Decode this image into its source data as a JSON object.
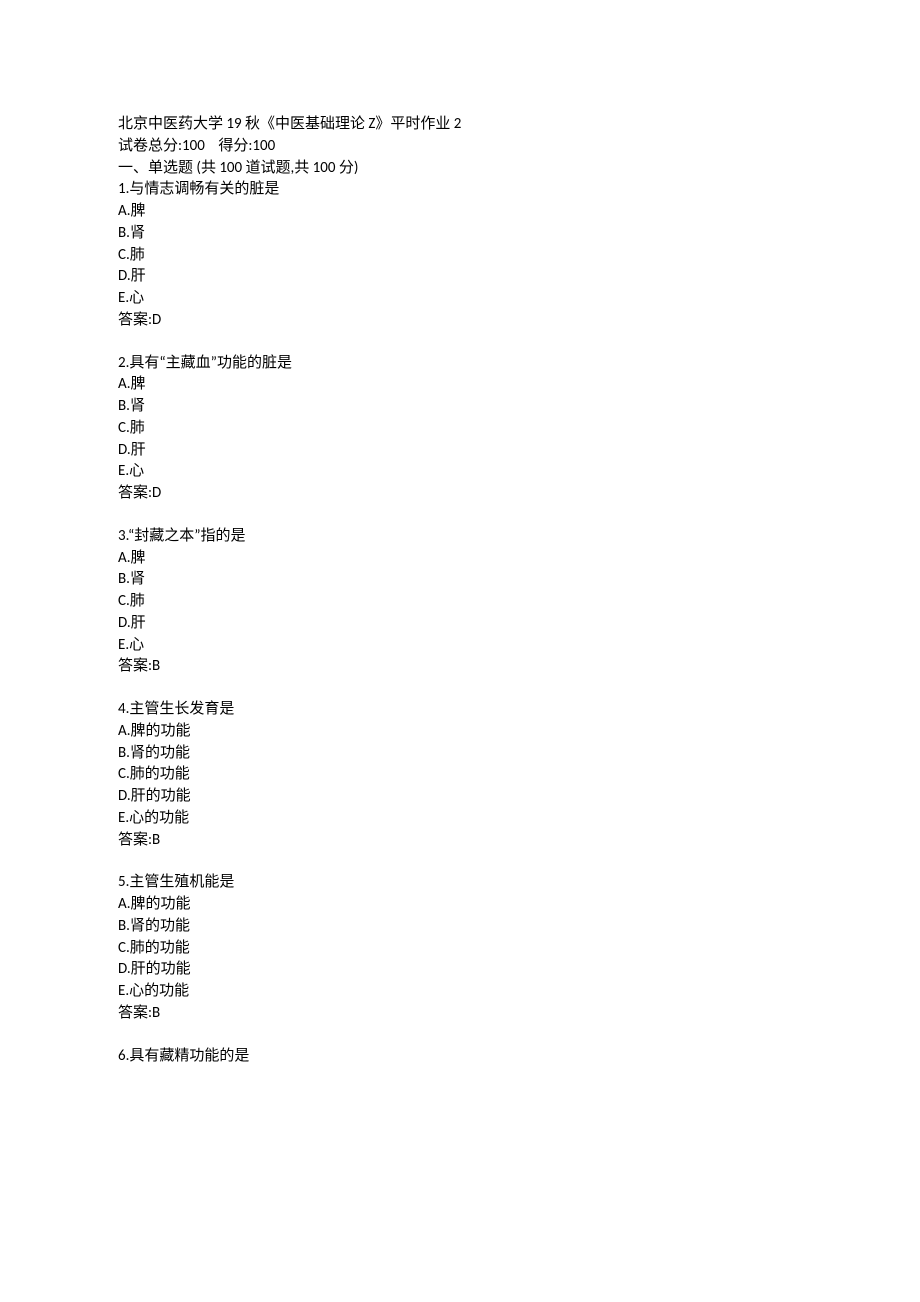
{
  "header": {
    "title": "北京中医药大学 19 秋《中医基础理论 Z》平时作业 2",
    "score_line": "试卷总分:100    得分:100",
    "section_line": "一、单选题 (共 100 道试题,共 100 分)"
  },
  "questions": [
    {
      "number": "1",
      "stem": "与情志调畅有关的脏是",
      "options": [
        "A.脾",
        "B.肾",
        "C.肺",
        "D.肝",
        "E.心"
      ],
      "answer": "答案:D"
    },
    {
      "number": "2",
      "stem": "具有\"主藏血\"功能的脏是",
      "options": [
        "A.脾",
        "B.肾",
        "C.肺",
        "D.肝",
        "E.心"
      ],
      "answer": "答案:D"
    },
    {
      "number": "3",
      "stem": "\"封藏之本\"指的是",
      "options": [
        "A.脾",
        "B.肾",
        "C.肺",
        "D.肝",
        "E.心"
      ],
      "answer": "答案:B"
    },
    {
      "number": "4",
      "stem": "主管生长发育是",
      "options": [
        "A.脾的功能",
        "B.肾的功能",
        "C.肺的功能",
        "D.肝的功能",
        "E.心的功能"
      ],
      "answer": "答案:B"
    },
    {
      "number": "5",
      "stem": "主管生殖机能是",
      "options": [
        "A.脾的功能",
        "B.肾的功能",
        "C.肺的功能",
        "D.肝的功能",
        "E.心的功能"
      ],
      "answer": "答案:B"
    },
    {
      "number": "6",
      "stem": "具有藏精功能的是",
      "options": [],
      "answer": ""
    }
  ],
  "quotes": {
    "open": "“",
    "close": "”"
  }
}
